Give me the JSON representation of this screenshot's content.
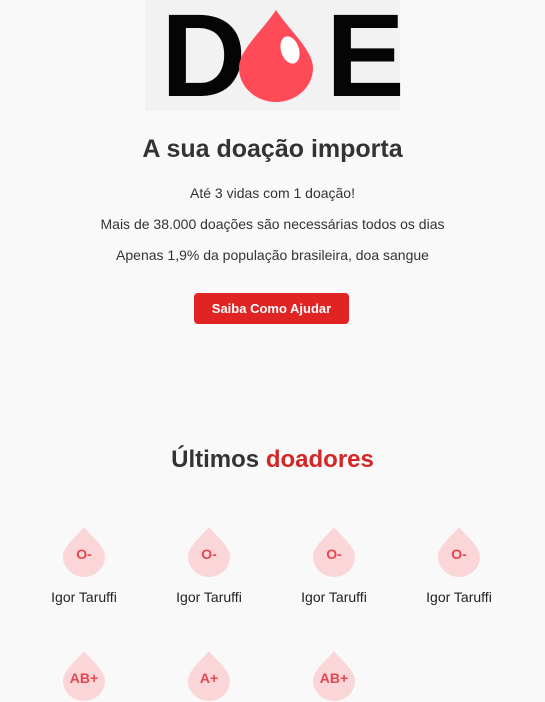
{
  "logo": {
    "letter_left": "D",
    "letter_right": "E",
    "drop_color": "#ff4b57"
  },
  "hero": {
    "title": "A sua doação importa",
    "lines": [
      "Até 3 vidas com 1 doação!",
      "Mais de 38.000 doações são necessárias todos os dias",
      "Apenas 1,9% da população brasileira, doa sangue"
    ],
    "cta_label": "Saiba Como Ajudar"
  },
  "donors_section": {
    "title_part1": "Últimos ",
    "title_part2": "doadores",
    "accent_color": "#d32626",
    "donors": [
      {
        "type": "O-",
        "name": "Igor Taruffi"
      },
      {
        "type": "O-",
        "name": "Igor Taruffi"
      },
      {
        "type": "O-",
        "name": "Igor Taruffi"
      },
      {
        "type": "O-",
        "name": "Igor Taruffi"
      },
      {
        "type": "AB+",
        "name": ""
      },
      {
        "type": "A+",
        "name": ""
      },
      {
        "type": "AB+",
        "name": ""
      }
    ]
  },
  "icons": {
    "logo_drop": "blood-drop-icon",
    "donor_drop": "blood-drop-icon"
  },
  "colors": {
    "primary": "#e02424",
    "drop_light": "#fbd6d9",
    "drop_text": "#e3474f",
    "background": "#f9f9f9"
  }
}
